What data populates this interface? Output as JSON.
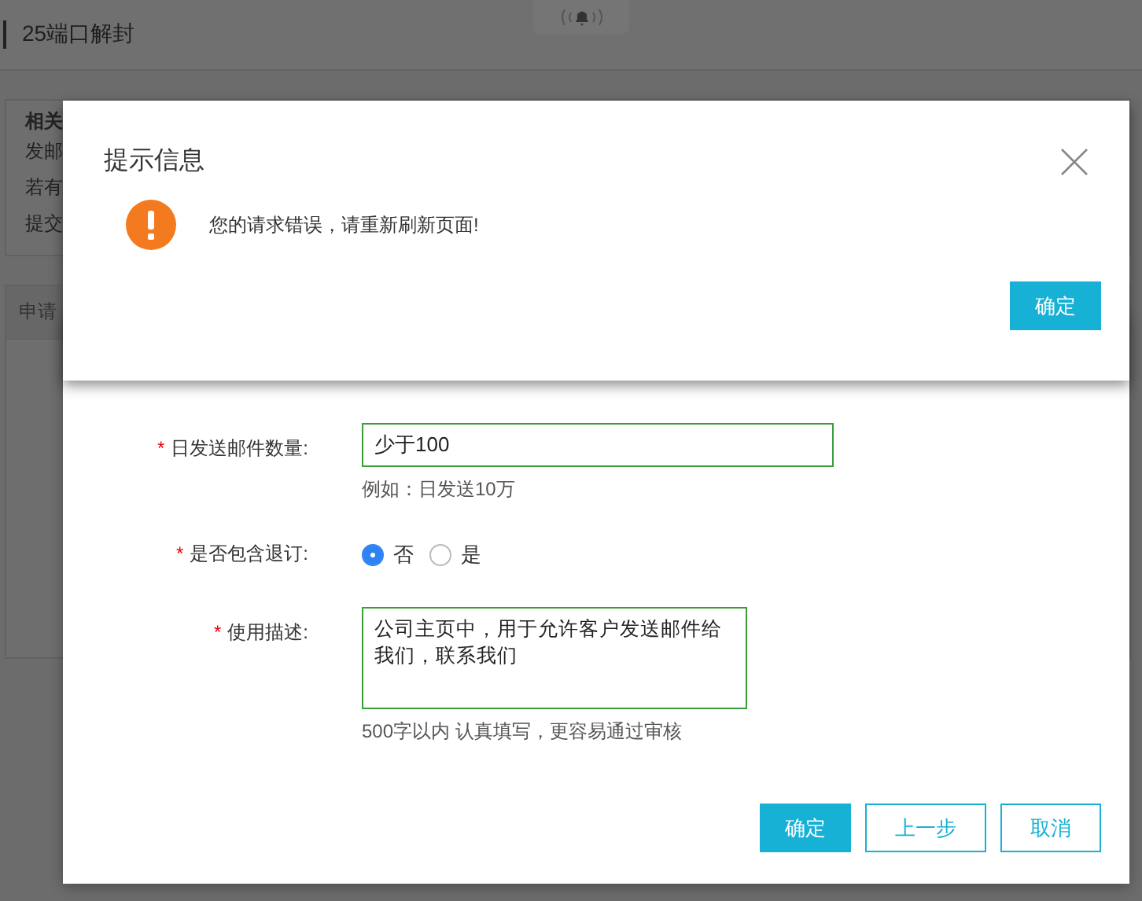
{
  "header": {
    "title": "25端口解封"
  },
  "background": {
    "info_lines": [
      "相关",
      "发邮",
      "若有",
      "提交"
    ],
    "section_title": "申请"
  },
  "form": {
    "fields": [
      {
        "kind": "input",
        "required_mark": "*",
        "label": "日发送邮件数量:",
        "value": "少于100",
        "hint": "例如：日发送10万"
      },
      {
        "kind": "radio",
        "required_mark": "*",
        "label": "是否包含退订:",
        "options": [
          {
            "label": "否",
            "selected": true
          },
          {
            "label": "是",
            "selected": false
          }
        ]
      },
      {
        "kind": "textarea",
        "required_mark": "*",
        "label": "使用描述:",
        "value": "公司主页中，用于允许客户发送邮件给我们，联系我们",
        "hint": "500字以内 认真填写，更容易通过审核"
      }
    ],
    "buttons": [
      {
        "label": "确定",
        "kind": "primary"
      },
      {
        "label": "上一步",
        "kind": "outline"
      },
      {
        "label": "取消",
        "kind": "outline"
      }
    ]
  },
  "alert": {
    "title": "提示信息",
    "message": "您的请求错误，请重新刷新页面!",
    "button": "确定"
  }
}
